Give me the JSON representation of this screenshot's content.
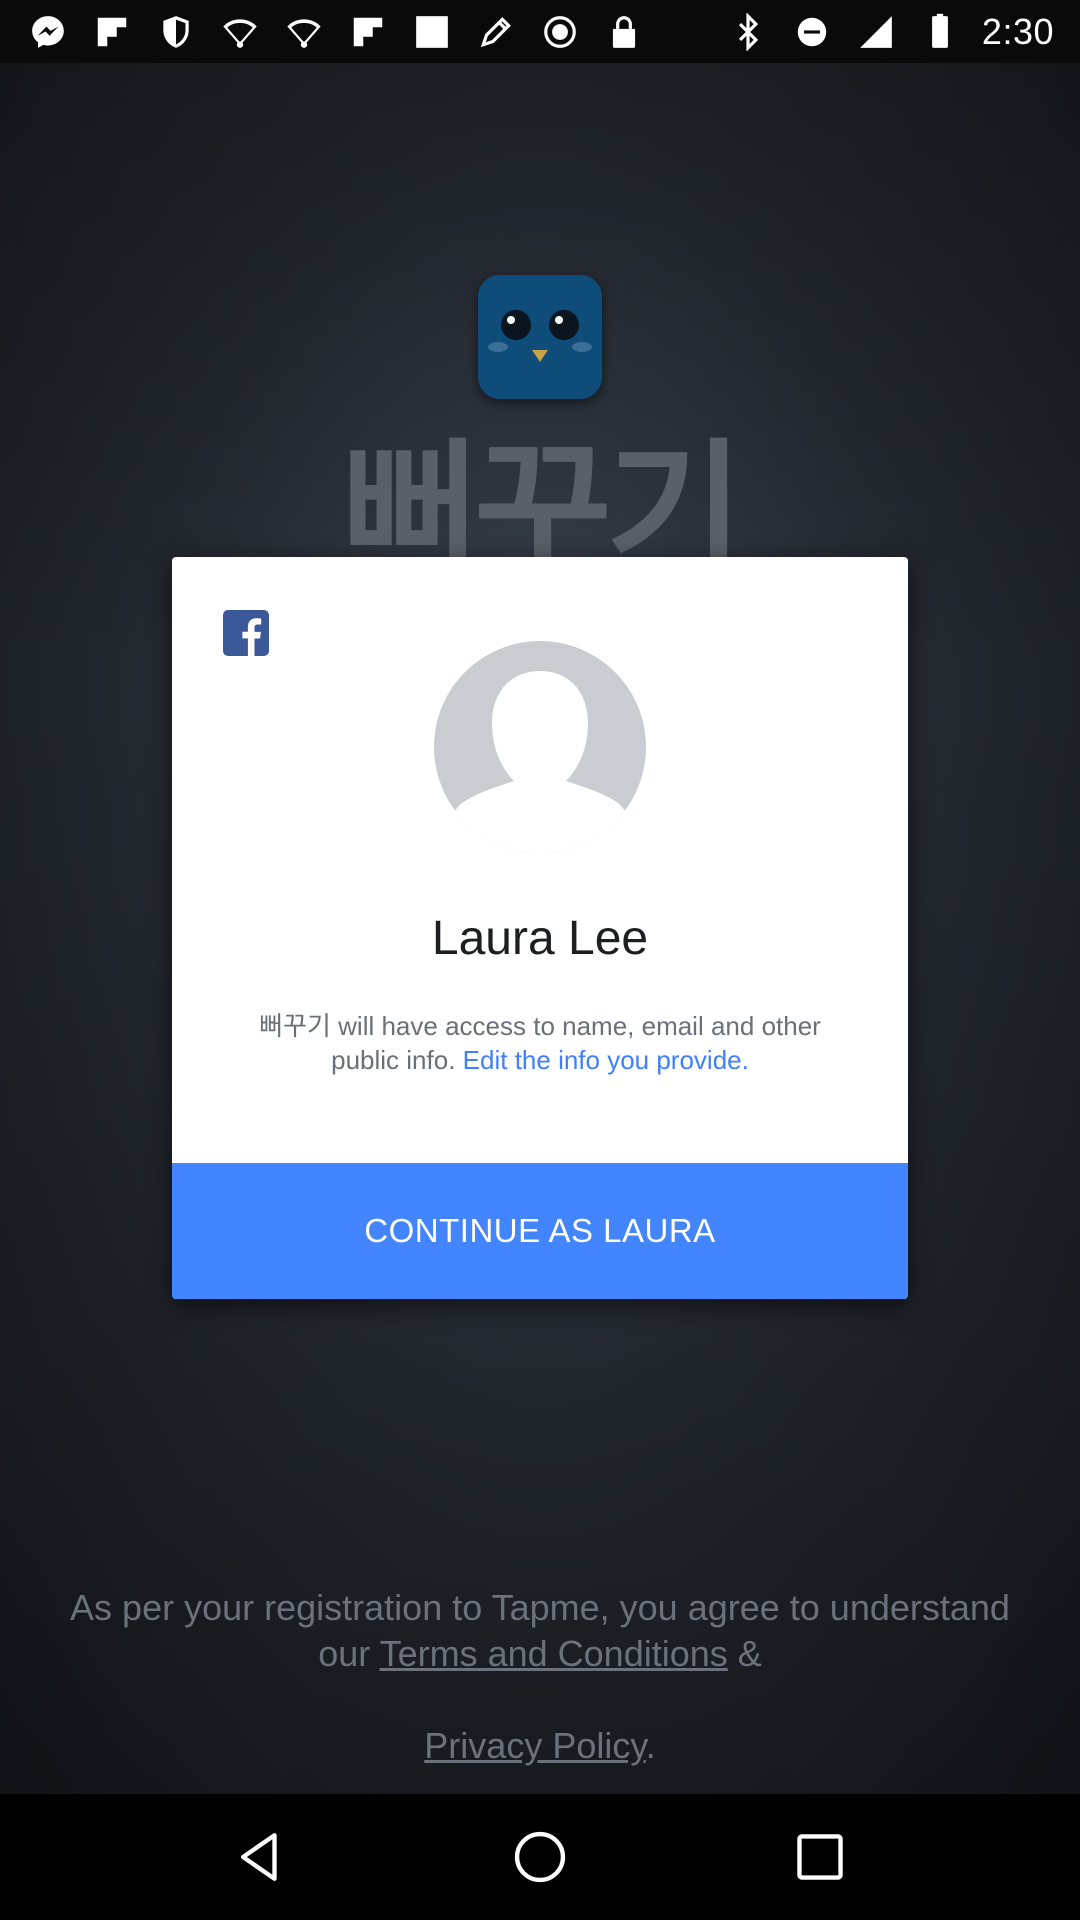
{
  "status_bar": {
    "time": "2:30",
    "icons": [
      "messenger-icon",
      "flipboard-icon",
      "shield-icon",
      "wifi-icon",
      "wifi-icon",
      "flipboard-icon",
      "image-icon",
      "pen-icon",
      "alarm-icon",
      "lock-icon",
      "bluetooth-icon",
      "do-not-disturb-icon",
      "signal-icon",
      "battery-icon"
    ]
  },
  "background_app": {
    "name": "뻐꾸기",
    "logo": "owl-app-icon",
    "legal": {
      "line1": "As per your registration to Tapme, you agree to understand",
      "our": "our",
      "terms": "Terms and Conditions",
      "amp": "&",
      "privacy": "Privacy Policy",
      "period": "."
    }
  },
  "dialog": {
    "provider_icon": "facebook-icon",
    "avatar": "default-profile-avatar",
    "name": "Laura Lee",
    "access_text": "뻐꾸기 will have access to name, email and other public info.",
    "edit_link": "Edit the info you provide.",
    "continue_label": "CONTINUE AS LAURA"
  },
  "colors": {
    "button": "#4384ff",
    "link": "#4080ff",
    "facebook": "#3b5998"
  },
  "nav_bar": {
    "buttons": [
      "back-icon",
      "home-icon",
      "recents-icon"
    ]
  }
}
